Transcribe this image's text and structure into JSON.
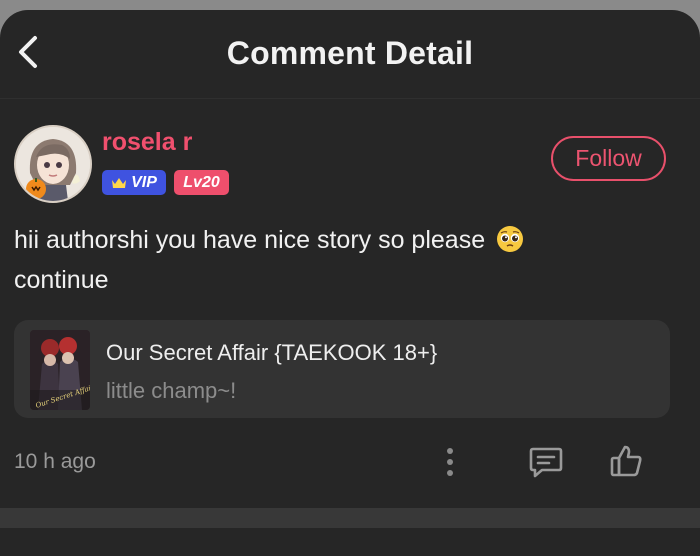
{
  "header": {
    "title": "Comment Detail",
    "back_icon": "chevron-left-icon"
  },
  "author": {
    "name": "rosela r",
    "vip_label": "VIP",
    "level_label": "Lv20",
    "follow_label": "Follow",
    "avatar_icon": "avatar-anime-girl"
  },
  "comment": {
    "text": "hii authorshi you have nice story so please",
    "text_end": "continue",
    "emoji": "pleading-face-emoji"
  },
  "story": {
    "title": "Our Secret Affair {TAEKOOK 18+}",
    "subtitle": "little champ~!",
    "cover_text": "Our Secret Affair"
  },
  "footer": {
    "timestamp": "10 h ago",
    "more_icon": "more-vertical-icon",
    "reply_icon": "comment-icon",
    "like_icon": "thumbs-up-icon"
  },
  "colors": {
    "accent": "#ec5470",
    "vip": "#3f53e0",
    "background": "#262626",
    "card": "#333333"
  }
}
